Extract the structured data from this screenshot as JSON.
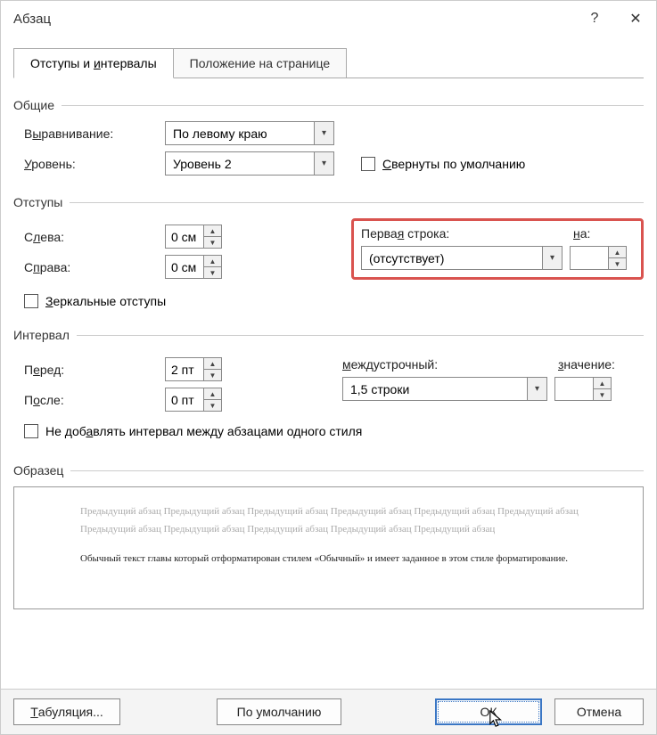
{
  "title": "Абзац",
  "help_symbol": "?",
  "close_symbol": "✕",
  "tabs": {
    "indents": {
      "pre": "Отступы и ",
      "ul": "и",
      "post": "нтервалы"
    },
    "position": "Положение на странице"
  },
  "groups": {
    "general": "Общие",
    "indents": "Отступы",
    "spacing": "Интервал",
    "preview": "Образец"
  },
  "general": {
    "alignment_label": {
      "pre": "В",
      "ul": "ы",
      "post": "равнивание:"
    },
    "alignment_value": "По левому краю",
    "level_label": {
      "pre": "",
      "ul": "У",
      "post": "ровень:"
    },
    "level_value": "Уровень 2",
    "collapsed_label": {
      "pre": "",
      "ul": "С",
      "post": "вернуты по умолчанию"
    }
  },
  "indents": {
    "left_label": {
      "pre": "С",
      "ul": "л",
      "post": "ева:"
    },
    "left_value": "0 см",
    "right_label": {
      "pre": "С",
      "ul": "п",
      "post": "рава:"
    },
    "right_value": "0 см",
    "mirror_label": {
      "pre": "",
      "ul": "З",
      "post": "еркальные отступы"
    },
    "firstline_label": {
      "pre": "Перва",
      "ul": "я",
      "post": " строка:"
    },
    "firstline_value": "(отсутствует)",
    "by_label": {
      "pre": "",
      "ul": "н",
      "post": "а:"
    },
    "by_value": ""
  },
  "spacing": {
    "before_label": {
      "pre": "П",
      "ul": "е",
      "post": "ред:"
    },
    "before_value": "2 пт",
    "after_label": {
      "pre": "П",
      "ul": "о",
      "post": "сле:"
    },
    "after_value": "0 пт",
    "noadd_label": {
      "pre": "Не доб",
      "ul": "а",
      "post": "влять интервал между абзацами одного стиля"
    },
    "linespacing_label": {
      "pre": "",
      "ul": "м",
      "post": "еждустрочный:"
    },
    "linespacing_value": "1,5 строки",
    "at_label": {
      "pre": "",
      "ul": "з",
      "post": "начение:"
    },
    "at_value": ""
  },
  "preview": {
    "gray": "Предыдущий абзац Предыдущий абзац Предыдущий абзац Предыдущий абзац Предыдущий абзац Предыдущий абзац Предыдущий абзац Предыдущий абзац Предыдущий абзац Предыдущий абзац Предыдущий абзац",
    "black": "Обычный текст главы который отформатирован стилем «Обычный» и имеет заданное в этом стиле форматирование."
  },
  "buttons": {
    "tabs": {
      "pre": "",
      "ul": "Т",
      "post": "абуляция..."
    },
    "default": "По умолчанию",
    "ok": "ОК",
    "cancel": "Отмена"
  },
  "icons": {
    "dropdown": "▾",
    "spin_up": "▲",
    "spin_down": "▼"
  }
}
